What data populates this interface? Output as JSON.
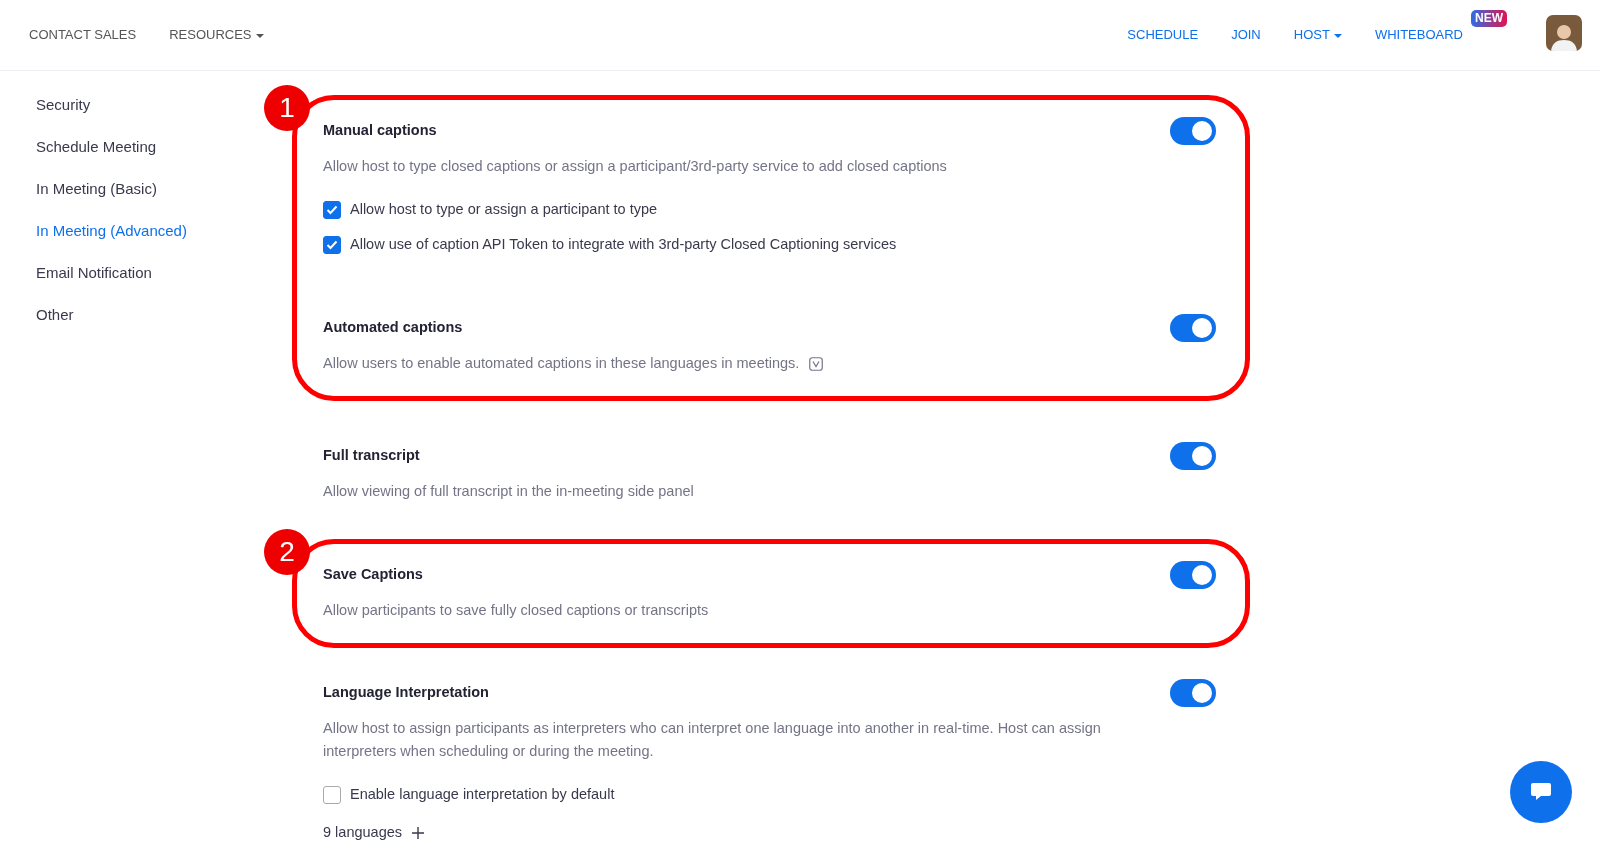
{
  "header": {
    "left_links": [
      {
        "label": "CONTACT SALES",
        "dropdown": false
      },
      {
        "label": "RESOURCES",
        "dropdown": true
      }
    ],
    "right_links": [
      {
        "label": "SCHEDULE",
        "dropdown": false
      },
      {
        "label": "JOIN",
        "dropdown": false
      },
      {
        "label": "HOST",
        "dropdown": true
      },
      {
        "label": "WHITEBOARD",
        "dropdown": false,
        "badge": "NEW"
      }
    ]
  },
  "sidebar": {
    "items": [
      {
        "label": "Security",
        "selected": false
      },
      {
        "label": "Schedule Meeting",
        "selected": false
      },
      {
        "label": "In Meeting (Basic)",
        "selected": false
      },
      {
        "label": "In Meeting (Advanced)",
        "selected": true
      },
      {
        "label": "Email Notification",
        "selected": false
      },
      {
        "label": "Other",
        "selected": false
      }
    ]
  },
  "groups": [
    {
      "callout": "1",
      "settings": [
        {
          "title": "Manual captions",
          "on": true,
          "description": "Allow host to type closed captions or assign a participant/3rd-party service to add closed captions",
          "options": [
            {
              "label": "Allow host to type or assign a participant to type",
              "checked": true
            },
            {
              "label": "Allow use of caption API Token to integrate with 3rd-party Closed Captioning services",
              "checked": true
            }
          ]
        },
        {
          "title": "Automated captions",
          "on": true,
          "description": "Allow users to enable automated captions in these languages in meetings.",
          "info_icon": true
        }
      ]
    },
    {
      "settings": [
        {
          "title": "Full transcript",
          "on": true,
          "description": "Allow viewing of full transcript in the in-meeting side panel"
        }
      ]
    },
    {
      "callout": "2",
      "settings": [
        {
          "title": "Save Captions",
          "on": true,
          "description": "Allow participants to save fully closed captions or transcripts"
        }
      ]
    },
    {
      "settings": [
        {
          "title": "Language Interpretation",
          "on": true,
          "description": "Allow host to assign participants as interpreters who can interpret one language into another in real-time. Host can assign interpreters when scheduling or during the meeting.",
          "options": [
            {
              "label": "Enable language interpretation by default",
              "checked": false
            }
          ],
          "add_link": "9 languages"
        }
      ]
    }
  ]
}
